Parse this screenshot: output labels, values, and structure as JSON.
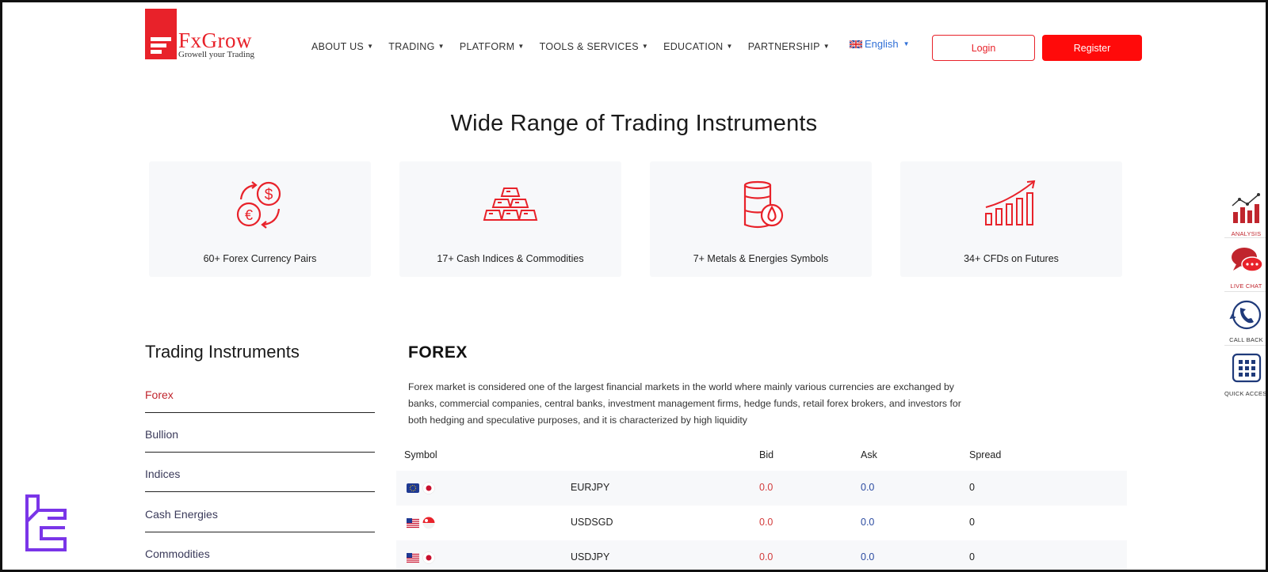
{
  "header": {
    "logo_name": "FxGrow",
    "logo_tagline": "Growell your Trading",
    "nav": [
      {
        "label": "ABOUT US"
      },
      {
        "label": "TRADING"
      },
      {
        "label": "PLATFORM"
      },
      {
        "label": "TOOLS & SERVICES"
      },
      {
        "label": "EDUCATION"
      },
      {
        "label": "PARTNERSHIP"
      }
    ],
    "language": "English",
    "login_label": "Login",
    "register_label": "Register"
  },
  "headline": "Wide Range of Trading Instruments",
  "cards": [
    {
      "label": "60+ Forex Currency Pairs",
      "icon": "currency-exchange-icon"
    },
    {
      "label": "17+ Cash Indices & Commodities",
      "icon": "gold-bars-icon"
    },
    {
      "label": "7+ Metals & Energies Symbols",
      "icon": "oil-barrel-icon"
    },
    {
      "label": "34+ CFDs on Futures",
      "icon": "growth-chart-icon"
    }
  ],
  "sidebar": {
    "title": "Trading Instruments",
    "items": [
      {
        "label": "Forex",
        "active": true
      },
      {
        "label": "Bullion"
      },
      {
        "label": "Indices"
      },
      {
        "label": "Cash Energies"
      },
      {
        "label": "Commodities"
      }
    ]
  },
  "forex": {
    "title": "FOREX",
    "description": "Forex market is considered one of the largest financial markets in the world where mainly various currencies are exchanged by banks, commercial companies, central banks, investment management firms, hedge funds, retail forex brokers, and investors for both hedging and speculative purposes, and it is characterized by high liquidity",
    "columns": [
      "Symbol",
      "Bid",
      "Ask",
      "Spread"
    ],
    "rows": [
      {
        "symbol": "EURJPY",
        "bid": "0.0",
        "ask": "0.0",
        "spread": "0",
        "flags": [
          "eu-flag-icon",
          "jp-flag-icon"
        ]
      },
      {
        "symbol": "USDSGD",
        "bid": "0.0",
        "ask": "0.0",
        "spread": "0",
        "flags": [
          "us-flag-icon",
          "sg-flag-icon"
        ]
      },
      {
        "symbol": "USDJPY",
        "bid": "0.0",
        "ask": "0.0",
        "spread": "0",
        "flags": [
          "us-flag-icon",
          "jp-flag-icon"
        ]
      }
    ]
  },
  "tools": [
    {
      "label": "ANALYSIS",
      "icon": "analysis-chart-icon"
    },
    {
      "label": "LIVE CHAT",
      "icon": "chat-bubbles-icon"
    },
    {
      "label": "CALL BACK",
      "icon": "phone-callback-icon"
    },
    {
      "label": "QUICK ACCESS",
      "icon": "grid-menu-icon"
    }
  ],
  "colors": {
    "brand_red": "#e8222a",
    "register_red": "#ff0a0a",
    "link_blue": "#2f6fd6",
    "ask_blue": "#2a4aa0"
  }
}
